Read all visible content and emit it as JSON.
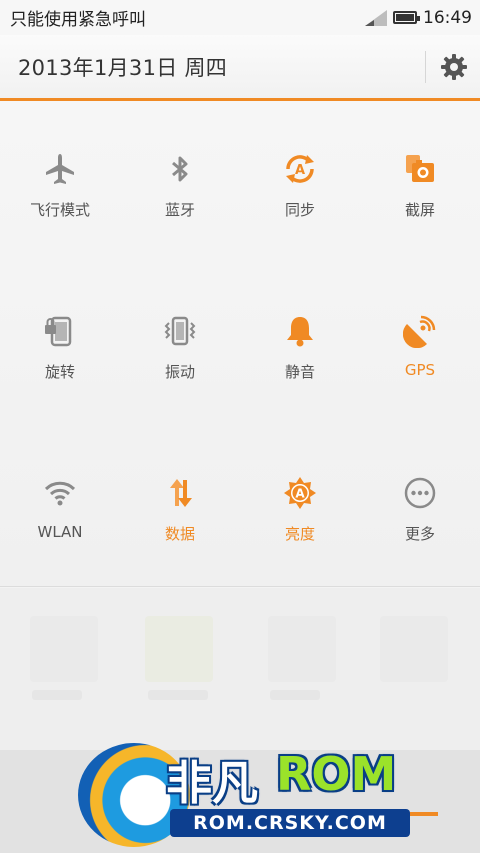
{
  "status_bar": {
    "carrier": "只能使用紧急呼叫",
    "time": "16:49",
    "battery_level": 0.9
  },
  "header": {
    "date": "2013年1月31日 周四",
    "settings_icon": "gear-icon"
  },
  "colors": {
    "accent": "#f08a24",
    "inactive": "#8a8a8a"
  },
  "toggles": [
    {
      "label": "飞行模式",
      "icon": "airplane-icon",
      "active": false
    },
    {
      "label": "蓝牙",
      "icon": "bluetooth-icon",
      "active": false
    },
    {
      "label": "同步",
      "icon": "sync-icon",
      "active": true
    },
    {
      "label": "截屏",
      "icon": "screenshot-icon",
      "active": true
    },
    {
      "label": "旋转",
      "icon": "rotation-lock-icon",
      "active": false
    },
    {
      "label": "振动",
      "icon": "vibrate-icon",
      "active": false
    },
    {
      "label": "静音",
      "icon": "bell-icon",
      "active": true
    },
    {
      "label": "GPS",
      "icon": "gps-icon",
      "active": true
    },
    {
      "label": "WLAN",
      "icon": "wifi-icon",
      "active": false
    },
    {
      "label": "数据",
      "icon": "data-icon",
      "active": true
    },
    {
      "label": "亮度",
      "icon": "brightness-icon",
      "active": true
    },
    {
      "label": "更多",
      "icon": "more-icon",
      "active": false
    }
  ],
  "watermark": {
    "title_part1": "非凡",
    "title_part2": "ROM",
    "url": "ROM.CRSKY.COM"
  }
}
